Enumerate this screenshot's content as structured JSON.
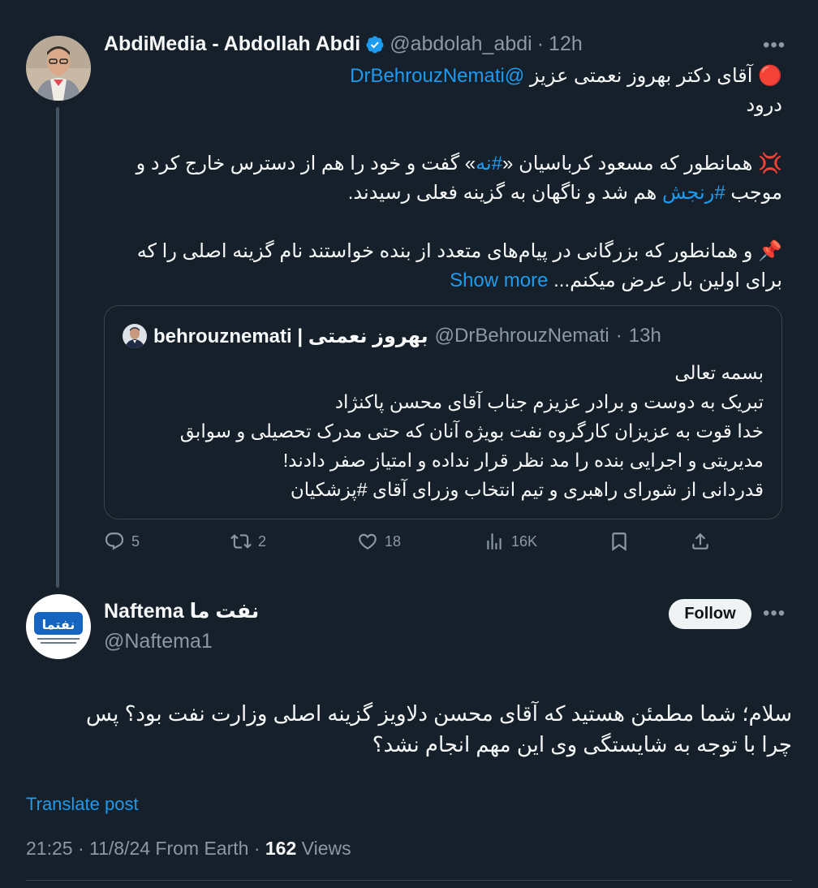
{
  "tweet1": {
    "name": "AbdiMedia - Abdollah Abdi",
    "handle": "@abdolah_abdi",
    "sep": "·",
    "time": "12h",
    "emoji1": "🔴",
    "line1_text": " آقای دکتر بهروز نعمتی عزیز ",
    "line1_mention": "@DrBehrouzNemati",
    "line2": "درود",
    "emoji2": "💢",
    "para2_a": " همانطور که مسعود کرباسیان «",
    "para2_hash1": "#نه",
    "para2_b": "» گفت و خود را هم از دسترس خارج کرد و موجب ",
    "para2_hash2": "#رنجش",
    "para2_c": " هم شد و ناگهان به گزینه فعلی رسیدند.",
    "emoji3": "📌",
    "para3_a": " و همانطور که بزرگانی در پیام‌های متعدد از بنده خواستند نام گزینه اصلی را که برای اولین بار عرض میکنم...",
    "show_more": "Show more"
  },
  "quote": {
    "name": "behrouznemati | بهروز نعمتی",
    "handle": "@DrBehrouzNemati",
    "sep": "·",
    "time": "13h",
    "lines": [
      "بسمه تعالی",
      "تبریک به دوست و برادر عزیزم جناب آقای محسن پاکنژاد",
      "خدا قوت به عزیزان کارگروه نفت بویژه آنان که حتی مدرک تحصیلی و سوابق",
      "مدیریتی و اجرایی بنده را مد نظر قرار نداده و امتیاز صفر دادند!",
      "قدردانی از شورای راهبری و تیم انتخاب وزرای آقای #پزشکیان"
    ]
  },
  "actions": {
    "replies": "5",
    "reposts": "2",
    "likes": "18",
    "views": "16K"
  },
  "tweet2": {
    "name": "Naftema نفت ما",
    "handle": "@Naftema1",
    "follow_label": "Follow",
    "avatar_logo": "نفتما",
    "body_line1": "سلام؛ شما مطمئن هستید که آقای محسن دلاویز گزینه اصلی وزارت نفت بود؟ پس",
    "body_line2": "چرا با توجه به شایستگی وی این مهم انجام نشد؟",
    "translate": "Translate post",
    "timestamp": "21:25 · 11/8/24 From Earth · ",
    "views_count": "162",
    "views_label": " Views"
  },
  "colors": {
    "background": "#15202b",
    "accent": "#1d9bf0",
    "muted": "#8b98a5",
    "border": "#38444d"
  },
  "icons": [
    "verified-badge-icon",
    "more-icon",
    "reply-icon",
    "repost-icon",
    "like-icon",
    "views-icon",
    "bookmark-icon",
    "share-icon"
  ]
}
